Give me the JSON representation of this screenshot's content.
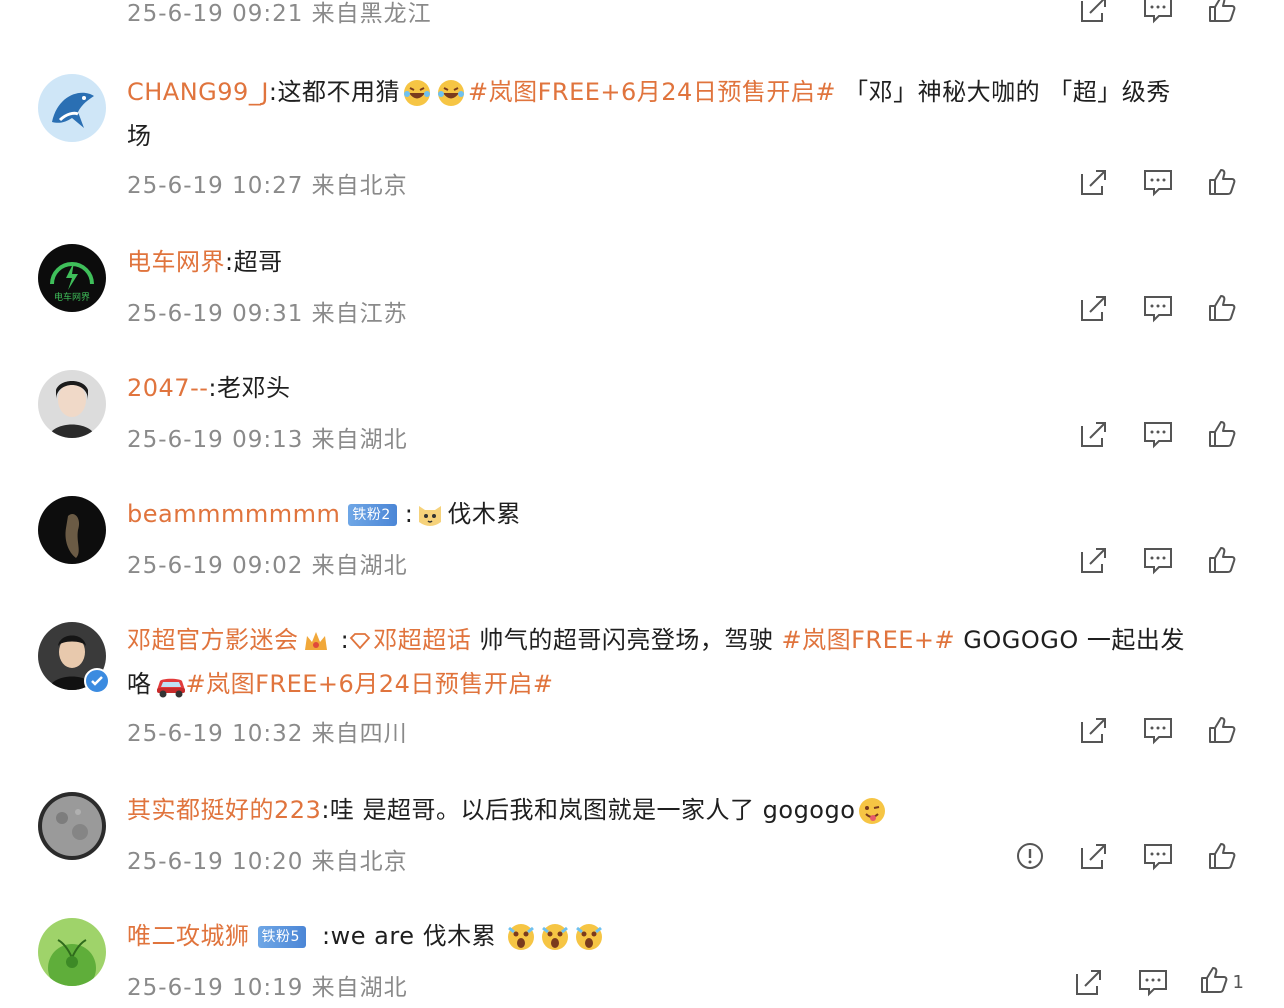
{
  "comments": [
    {
      "meta": "25-6-19 09:21 来自黑龙江"
    },
    {
      "user": "CHANG99_J",
      "text1": ":这都不用猜",
      "tag": "#岚图FREE+6月24日预售开启#",
      "text2": " 「邓」神秘大咖的 「超」级秀",
      "text3": "场",
      "meta": "25-6-19 10:27 来自北京"
    },
    {
      "user": "电车网界",
      "text1": ":超哥",
      "avatar_text": "电车网界",
      "meta": "25-6-19 09:31 来自江苏"
    },
    {
      "user": "2047--",
      "text1": ":老邓头",
      "meta": "25-6-19 09:13 来自湖北"
    },
    {
      "user": "beammmmmmm",
      "badge": "铁粉2",
      "text1": ":",
      "text2": "伐木累",
      "meta": "25-6-19 09:02 来自湖北"
    },
    {
      "user": "邓超官方影迷会",
      "text1": " :",
      "link": "邓超超话",
      "text2": " 帅气的超哥闪亮登场，驾驶 ",
      "tag1": "#岚图FREE+#",
      "text3": " GOGOGO 一起出发",
      "text4": "咯",
      "tag2": "#岚图FREE+6月24日预售开启#",
      "meta": "25-6-19 10:32 来自四川"
    },
    {
      "user": "其实都挺好的223",
      "text1": ":哇 是超哥。以后我和岚图就是一家人了 gogogo",
      "meta": "25-6-19 10:20 来自北京"
    },
    {
      "user": "唯二攻城狮",
      "badge": "铁粉5",
      "text1": " :we are 伐木累 ",
      "meta": "25-6-19 10:19 来自湖北",
      "like_count": "1"
    }
  ],
  "icons": {
    "share": "share-icon",
    "comment": "comment-icon",
    "like": "like-icon",
    "report": "report-icon"
  },
  "colors": {
    "username": "#e0743d",
    "meta": "#8a8a8a",
    "text": "#1f1f1f"
  }
}
